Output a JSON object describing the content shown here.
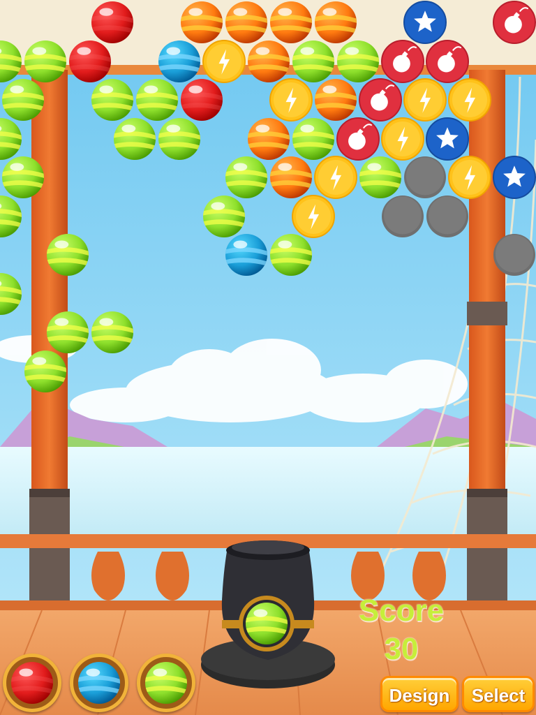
{
  "hud": {
    "score_label": "Score",
    "score_value": "30"
  },
  "buttons": {
    "design_label": "Design",
    "select_label": "Select"
  },
  "colors": {
    "red": "#e21c1c",
    "orange": "#ff7a10",
    "green": "#8ee02c",
    "blue": "#1a9ed8",
    "yellow": "#ffc21a",
    "bomb_red": "#e0303f",
    "star_blue": "#1d63c9",
    "stone_gray": "#6f6f6f"
  },
  "bubbles": [
    {
      "kind": "red",
      "row": 0,
      "col": 2
    },
    {
      "kind": "orange",
      "row": 0,
      "col": 4
    },
    {
      "kind": "orange",
      "row": 0,
      "col": 5
    },
    {
      "kind": "orange",
      "row": 0,
      "col": 6
    },
    {
      "kind": "orange",
      "row": 0,
      "col": 7
    },
    {
      "kind": "star",
      "row": 0,
      "col": 9
    },
    {
      "kind": "bomb",
      "row": 0,
      "col": 11
    },
    {
      "kind": "green",
      "row": 1,
      "col": 0
    },
    {
      "kind": "green",
      "row": 1,
      "col": 1
    },
    {
      "kind": "red",
      "row": 1,
      "col": 2
    },
    {
      "kind": "blue",
      "row": 1,
      "col": 4
    },
    {
      "kind": "lightning",
      "row": 1,
      "col": 5
    },
    {
      "kind": "orange",
      "row": 1,
      "col": 6
    },
    {
      "kind": "green",
      "row": 1,
      "col": 7
    },
    {
      "kind": "green",
      "row": 1,
      "col": 8
    },
    {
      "kind": "bomb",
      "row": 1,
      "col": 9
    },
    {
      "kind": "bomb",
      "row": 1,
      "col": 10
    },
    {
      "kind": "green",
      "row": 2,
      "col": 0
    },
    {
      "kind": "green",
      "row": 2,
      "col": 2
    },
    {
      "kind": "green",
      "row": 2,
      "col": 3
    },
    {
      "kind": "red",
      "row": 2,
      "col": 4
    },
    {
      "kind": "lightning",
      "row": 2,
      "col": 6
    },
    {
      "kind": "orange",
      "row": 2,
      "col": 7
    },
    {
      "kind": "bomb",
      "row": 2,
      "col": 8
    },
    {
      "kind": "lightning",
      "row": 2,
      "col": 9
    },
    {
      "kind": "lightning",
      "row": 2,
      "col": 10
    },
    {
      "kind": "green",
      "row": 3,
      "col": 0
    },
    {
      "kind": "green",
      "row": 3,
      "col": 3
    },
    {
      "kind": "green",
      "row": 3,
      "col": 4
    },
    {
      "kind": "orange",
      "row": 3,
      "col": 6
    },
    {
      "kind": "green",
      "row": 3,
      "col": 7
    },
    {
      "kind": "bomb",
      "row": 3,
      "col": 8
    },
    {
      "kind": "lightning",
      "row": 3,
      "col": 9
    },
    {
      "kind": "star",
      "row": 3,
      "col": 10
    },
    {
      "kind": "green",
      "row": 4,
      "col": 0
    },
    {
      "kind": "green",
      "row": 4,
      "col": 5
    },
    {
      "kind": "orange",
      "row": 4,
      "col": 6
    },
    {
      "kind": "lightning",
      "row": 4,
      "col": 7
    },
    {
      "kind": "green",
      "row": 4,
      "col": 8
    },
    {
      "kind": "stone",
      "row": 4,
      "col": 9
    },
    {
      "kind": "lightning",
      "row": 4,
      "col": 10
    },
    {
      "kind": "star",
      "row": 4,
      "col": 11
    },
    {
      "kind": "green",
      "row": 5,
      "col": 0
    },
    {
      "kind": "green",
      "row": 5,
      "col": 5
    },
    {
      "kind": "lightning",
      "row": 5,
      "col": 7
    },
    {
      "kind": "stone",
      "row": 5,
      "col": 9
    },
    {
      "kind": "stone",
      "row": 5,
      "col": 10
    },
    {
      "kind": "green",
      "row": 6,
      "col": 1
    },
    {
      "kind": "blue",
      "row": 6,
      "col": 5
    },
    {
      "kind": "green",
      "row": 6,
      "col": 6
    },
    {
      "kind": "stone",
      "row": 6,
      "col": 11
    },
    {
      "kind": "green",
      "row": 7,
      "col": 0
    },
    {
      "kind": "green",
      "row": 8,
      "col": 1
    },
    {
      "kind": "green",
      "row": 8,
      "col": 2
    },
    {
      "kind": "green",
      "row": 9,
      "col": 1
    }
  ],
  "cannon": {
    "loaded": "green"
  },
  "queue": [
    "red",
    "blue",
    "green"
  ]
}
